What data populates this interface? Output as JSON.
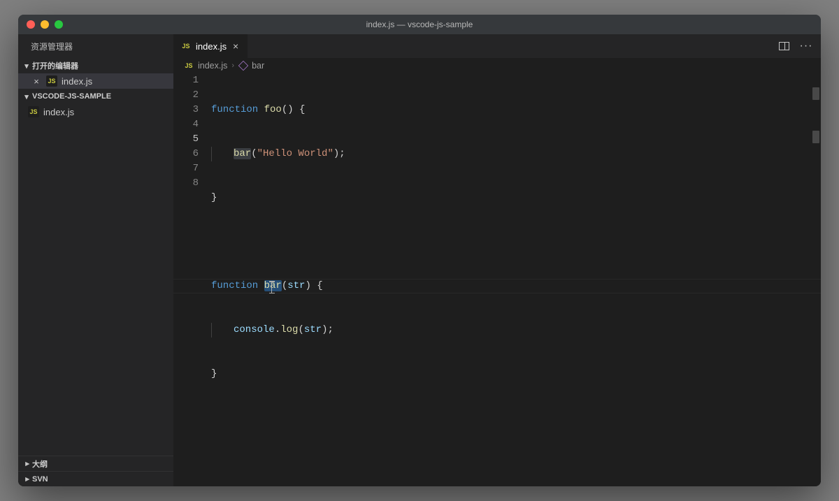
{
  "titlebar": {
    "title": "index.js — vscode-js-sample"
  },
  "sidebar": {
    "title": "资源管理器",
    "open_editors_label": "打开的编辑器",
    "folder_label": "VSCODE-JS-SAMPLE",
    "outline_label": "大纲",
    "svn_label": "SVN",
    "open_file": "index.js",
    "tree_file": "index.js",
    "js_badge": "JS"
  },
  "tab": {
    "label": "index.js",
    "js_badge": "JS"
  },
  "breadcrumbs": {
    "file": "index.js",
    "symbol": "bar",
    "js_badge": "JS"
  },
  "code": {
    "line_numbers": [
      "1",
      "2",
      "3",
      "4",
      "5",
      "6",
      "7",
      "8"
    ],
    "current_line": 5,
    "l1": {
      "kw": "function",
      "name": "foo",
      "rest": "() {"
    },
    "l2": {
      "fn": "bar",
      "str": "\"Hello World\"",
      "open": "(",
      "close": ");"
    },
    "l3": {
      "brace": "}"
    },
    "l5": {
      "kw": "function",
      "name": "bar",
      "open": "(",
      "param": "str",
      "rest": ") {"
    },
    "l6": {
      "obj": "console",
      "dot": ".",
      "fn": "log",
      "open": "(",
      "param": "str",
      "close": ");"
    },
    "l7": {
      "brace": "}"
    }
  }
}
